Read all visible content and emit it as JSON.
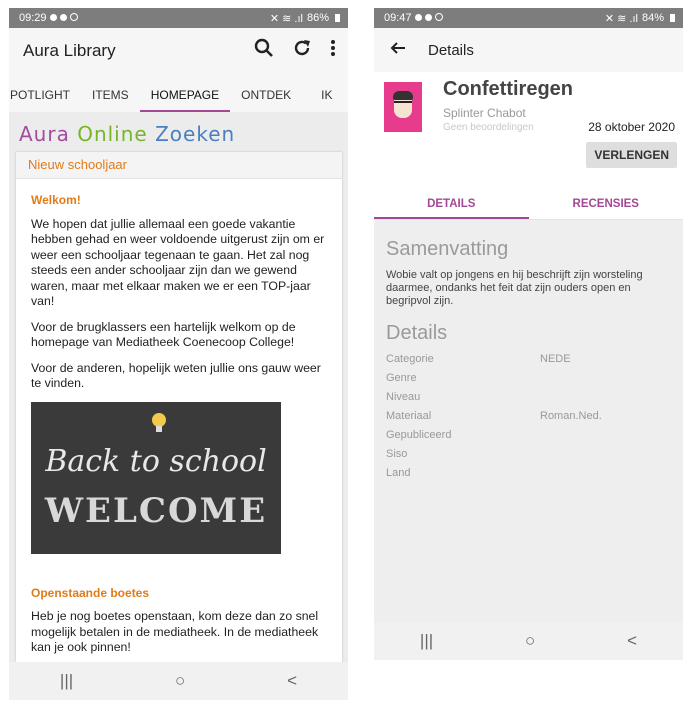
{
  "left": {
    "status": {
      "time": "09:29",
      "right": "86%"
    },
    "app_title": "Aura Library",
    "tabs": [
      "POTLIGHT",
      "ITEMS",
      "HOMEPAGE",
      "ONTDEK",
      "IK"
    ],
    "banner": {
      "w1": "Aura",
      "w2": "Online",
      "w3": "Zoeken"
    },
    "card_header": "Nieuw schooljaar",
    "welcome_heading": "Welkom!",
    "para1": "We hopen dat jullie allemaal een goede vakantie hebben gehad en weer voldoende uitgerust zijn om er weer een schooljaar tegenaan te gaan. Het zal nog steeds een ander schooljaar zijn dan we gewend waren, maar met elkaar maken we er een TOP-jaar van!",
    "para2": "Voor de brugklassers een hartelijk welkom op de homepage van Mediatheek Coenecoop College!",
    "para3": "Voor de anderen, hopelijk weten jullie ons gauw weer te vinden.",
    "image_text1": "Back to school",
    "image_text2": "WELCOME",
    "fines_heading": "Openstaande boetes",
    "para4": "Heb je nog boetes openstaan, kom deze dan zo snel mogelijk betalen in de mediatheek. In de mediatheek kan je ook pinnen!"
  },
  "right": {
    "status": {
      "time": "09:47",
      "right": "84%"
    },
    "title": "Details",
    "book_title": "Confettiregen",
    "author": "Splinter Chabot",
    "rating": "Geen beoordelingen",
    "date": "28 oktober 2020",
    "renew": "VERLENGEN",
    "tabs": [
      "DETAILS",
      "RECENSIES"
    ],
    "summary_heading": "Samenvatting",
    "summary": "Wobie valt op jongens en hij beschrijft zijn worsteling daarmee, ondanks het feit dat zijn ouders open en begripvol zijn.",
    "details_heading": "Details",
    "details": [
      {
        "k": "Categorie",
        "v": "NEDE"
      },
      {
        "k": "Genre",
        "v": ""
      },
      {
        "k": "Niveau",
        "v": ""
      },
      {
        "k": "Materiaal",
        "v": "Roman.Ned."
      },
      {
        "k": "Gepubliceerd",
        "v": ""
      },
      {
        "k": "Siso",
        "v": ""
      },
      {
        "k": "Land",
        "v": ""
      }
    ]
  },
  "nav": {
    "recents": "|||",
    "home": "○",
    "back": "<"
  }
}
